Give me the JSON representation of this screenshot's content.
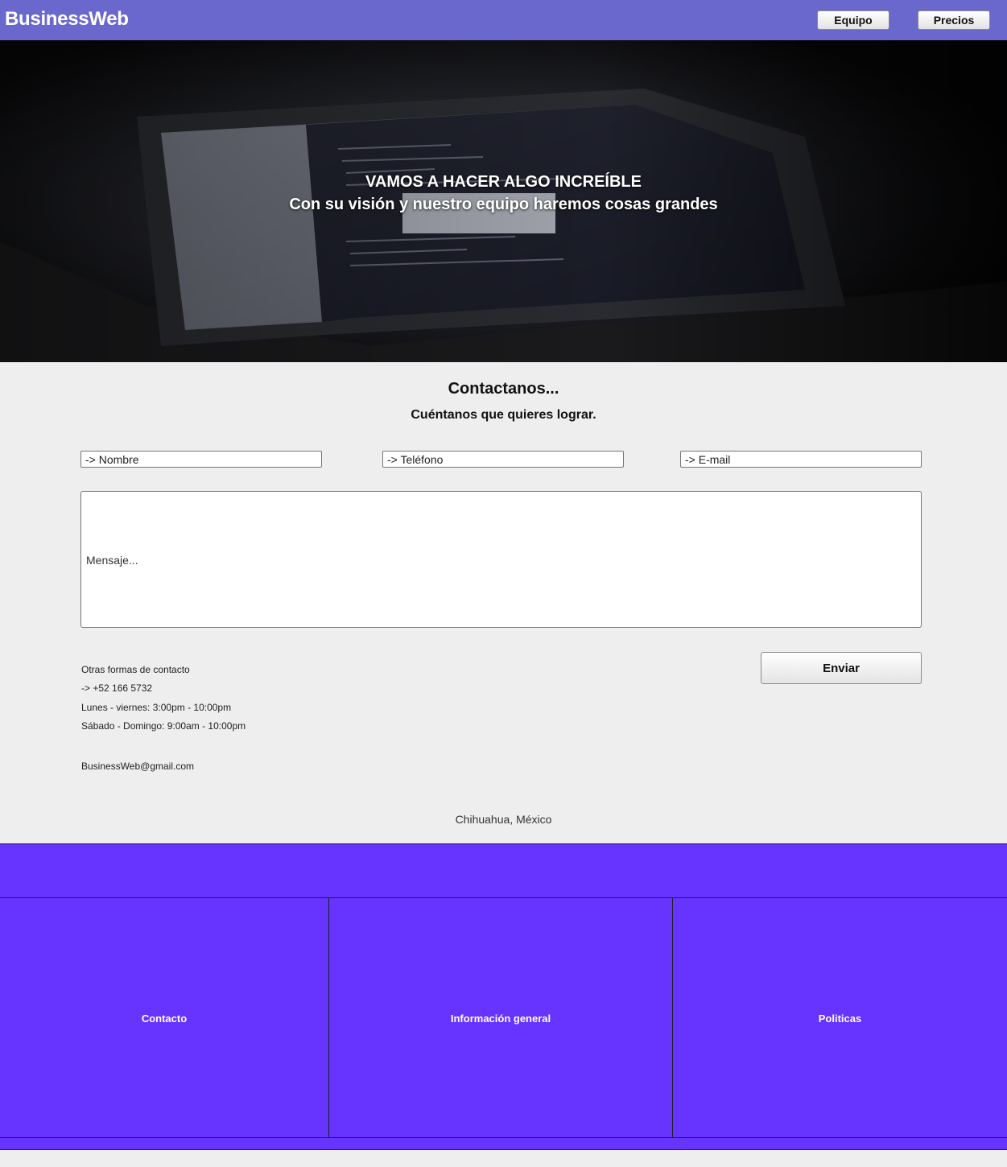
{
  "header": {
    "brand": "BusinessWeb",
    "nav": [
      {
        "label": "Equipo"
      },
      {
        "label": "Precios"
      }
    ]
  },
  "hero": {
    "title": "VAMOS A HACER ALGO INCREÍBLE",
    "subtitle": "Con su visión y nuestro equipo haremos cosas grandes"
  },
  "contact": {
    "title": "Contactanos...",
    "subtitle": "Cuéntanos que quieres lograr.",
    "fields": {
      "nombre_placeholder": "-> Nombre",
      "telefono_placeholder": "-> Teléfono",
      "email_placeholder": "-> E-mail",
      "mensaje_placeholder": "Mensaje..."
    },
    "send_label": "Enviar",
    "other": {
      "heading": "Otras formas de contacto",
      "phone": "-> +52 166 5732",
      "hours_weekdays": "Lunes - viernes: 3:00pm - 10:00pm",
      "hours_weekend": "Sábado - Domingo: 9:00am - 10:00pm",
      "email": "BusinessWeb@gmail.com"
    },
    "location": "Chihuahua, México"
  },
  "footer": {
    "columns": [
      {
        "label": "Contacto"
      },
      {
        "label": "Información general"
      },
      {
        "label": "Politicas"
      }
    ]
  },
  "colors": {
    "topbar": "#6a68cc",
    "footer": "#6633ff",
    "background": "#eeeeee"
  }
}
